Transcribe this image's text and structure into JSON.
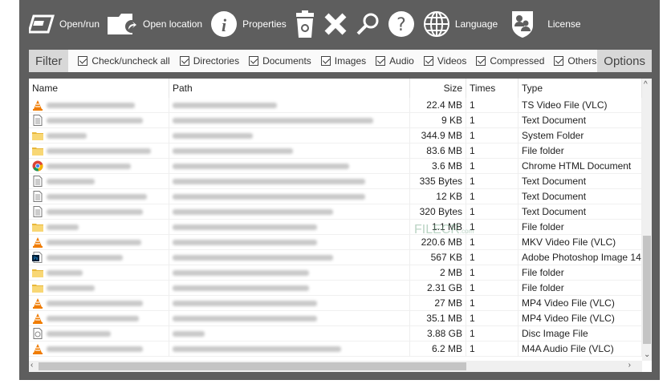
{
  "toolbar": {
    "open_run": "Open/run",
    "open_location": "Open location",
    "properties": "Properties",
    "language": "Language",
    "license": "License"
  },
  "filter": {
    "label": "Filter",
    "options_label": "Options",
    "checks": [
      "Check/uncheck all",
      "Directories",
      "Documents",
      "Images",
      "Audio",
      "Videos",
      "Compressed",
      "Others"
    ]
  },
  "table": {
    "headers": {
      "name": "Name",
      "path": "Path",
      "size": "Size",
      "times": "Times",
      "type": "Type"
    },
    "rows": [
      {
        "icon": "vlc",
        "size": "22.4 MB",
        "times": "1",
        "type": "TS Video File (VLC)"
      },
      {
        "icon": "text",
        "size": "9 KB",
        "times": "1",
        "type": "Text Document"
      },
      {
        "icon": "folder",
        "size": "344.9 MB",
        "times": "1",
        "type": "System Folder"
      },
      {
        "icon": "folder",
        "size": "83.6 MB",
        "times": "1",
        "type": "File folder"
      },
      {
        "icon": "chrome",
        "size": "3.6 MB",
        "times": "1",
        "type": "Chrome HTML Document"
      },
      {
        "icon": "text",
        "size": "335 Bytes",
        "times": "1",
        "type": "Text Document"
      },
      {
        "icon": "text",
        "size": "12 KB",
        "times": "1",
        "type": "Text Document"
      },
      {
        "icon": "text",
        "size": "320 Bytes",
        "times": "1",
        "type": "Text Document"
      },
      {
        "icon": "folder",
        "size": "1.1 MB",
        "times": "1",
        "type": "File folder"
      },
      {
        "icon": "vlc",
        "size": "220.6 MB",
        "times": "1",
        "type": "MKV Video File (VLC)"
      },
      {
        "icon": "photoshop",
        "size": "567 KB",
        "times": "1",
        "type": "Adobe Photoshop Image 14"
      },
      {
        "icon": "folder",
        "size": "2 MB",
        "times": "1",
        "type": "File folder"
      },
      {
        "icon": "folder",
        "size": "2.31 GB",
        "times": "1",
        "type": "File folder"
      },
      {
        "icon": "vlc",
        "size": "27 MB",
        "times": "1",
        "type": "MP4 Video File (VLC)"
      },
      {
        "icon": "vlc",
        "size": "35.1 MB",
        "times": "1",
        "type": "MP4 Video File (VLC)"
      },
      {
        "icon": "disc",
        "size": "3.88 GB",
        "times": "1",
        "type": "Disc Image File"
      },
      {
        "icon": "vlc",
        "size": "6.2 MB",
        "times": "1",
        "type": "M4A Audio File (VLC)"
      }
    ]
  },
  "watermark": {
    "text": "FILECR",
    ".com": ".com"
  }
}
